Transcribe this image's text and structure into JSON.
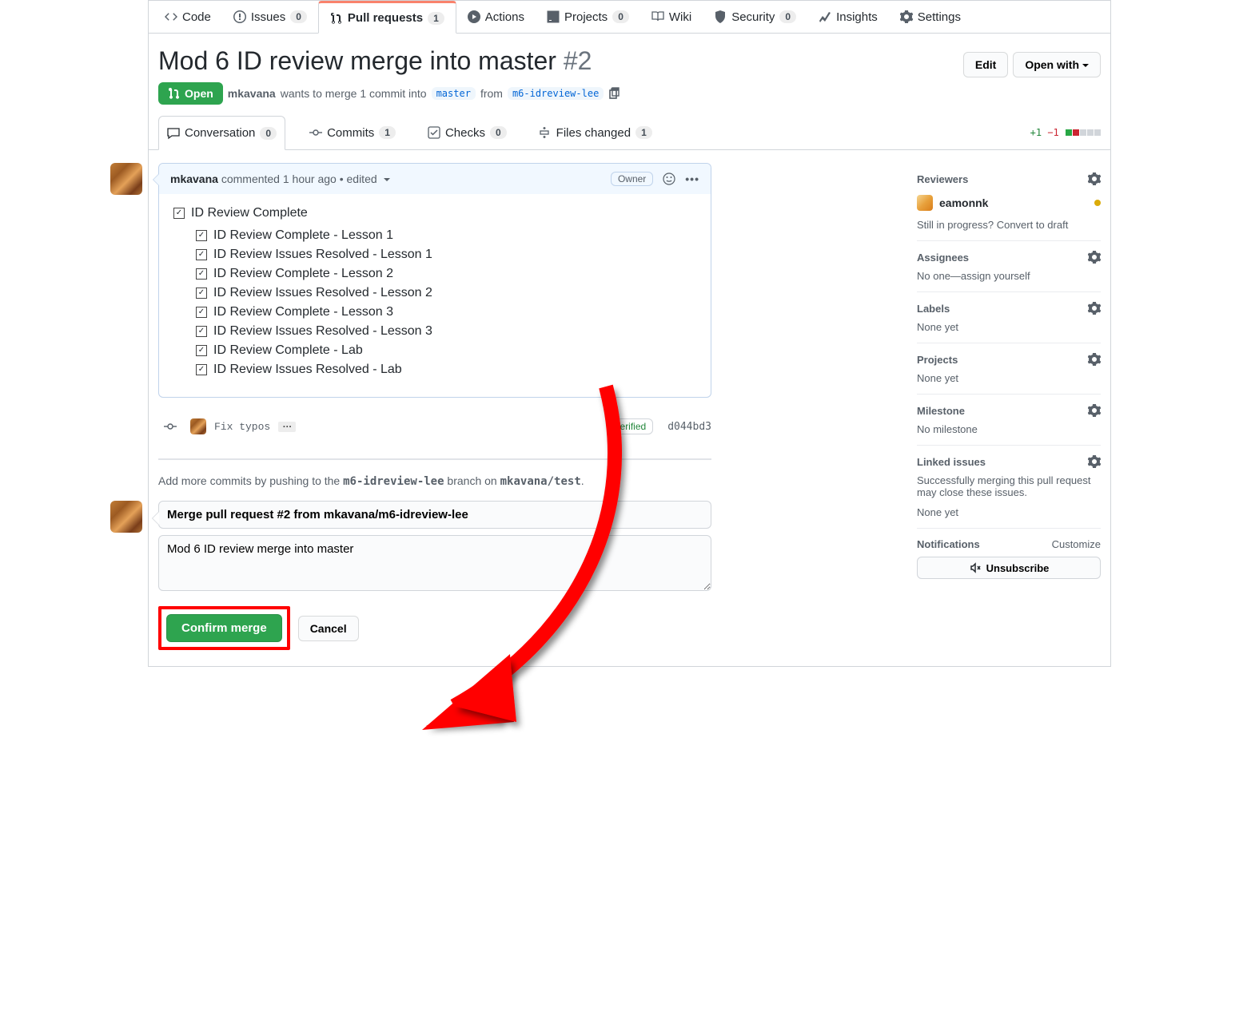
{
  "repo_tabs": {
    "code": "Code",
    "issues": "Issues",
    "issues_count": "0",
    "pulls": "Pull requests",
    "pulls_count": "1",
    "actions": "Actions",
    "projects": "Projects",
    "projects_count": "0",
    "wiki": "Wiki",
    "security": "Security",
    "security_count": "0",
    "insights": "Insights",
    "settings": "Settings"
  },
  "pr": {
    "title": "Mod 6 ID review merge into master",
    "number": "#2",
    "state": "Open",
    "author": "mkavana",
    "meta_text": "wants to merge 1 commit into",
    "base": "master",
    "from_word": "from",
    "head": "m6-idreview-lee",
    "edit_btn": "Edit",
    "open_with_btn": "Open with"
  },
  "pr_tabs": {
    "conversation": "Conversation",
    "conversation_count": "0",
    "commits": "Commits",
    "commits_count": "1",
    "checks": "Checks",
    "checks_count": "0",
    "files": "Files changed",
    "files_count": "1",
    "diff_add": "+1",
    "diff_del": "−1"
  },
  "comment": {
    "author": "mkavana",
    "ts": "commented 1 hour ago",
    "edited": "• edited",
    "owner_badge": "Owner",
    "task_root": "ID Review Complete",
    "tasks": [
      "ID Review Complete - Lesson 1",
      "ID Review Issues Resolved - Lesson 1",
      "ID Review Complete - Lesson 2",
      "ID Review Issues Resolved - Lesson 2",
      "ID Review Complete - Lesson 3",
      "ID Review Issues Resolved - Lesson 3",
      "ID Review Complete - Lab",
      "ID Review Issues Resolved - Lab"
    ]
  },
  "commit": {
    "message": "Fix typos",
    "verified": "Verified",
    "sha": "d044bd3"
  },
  "hint": {
    "pre": "Add more commits by pushing to the ",
    "branch": "m6-idreview-lee",
    "mid": " branch on ",
    "repo": "mkavana/test",
    "post": "."
  },
  "merge": {
    "title_value": "Merge pull request #2 from mkavana/m6-idreview-lee",
    "desc_value": "Mod 6 ID review merge into master",
    "confirm_btn": "Confirm merge",
    "cancel_btn": "Cancel"
  },
  "sidebar": {
    "reviewers_h": "Reviewers",
    "reviewer_name": "eamonnk",
    "draft_hint": "Still in progress? Convert to draft",
    "assignees_h": "Assignees",
    "assignees_none": "No one—assign yourself",
    "labels_h": "Labels",
    "labels_none": "None yet",
    "projects_h": "Projects",
    "projects_none": "None yet",
    "milestone_h": "Milestone",
    "milestone_none": "No milestone",
    "linked_h": "Linked issues",
    "linked_hint": "Successfully merging this pull request may close these issues.",
    "linked_none": "None yet",
    "notifications_h": "Notifications",
    "customize": "Customize",
    "unsubscribe": "Unsubscribe"
  }
}
